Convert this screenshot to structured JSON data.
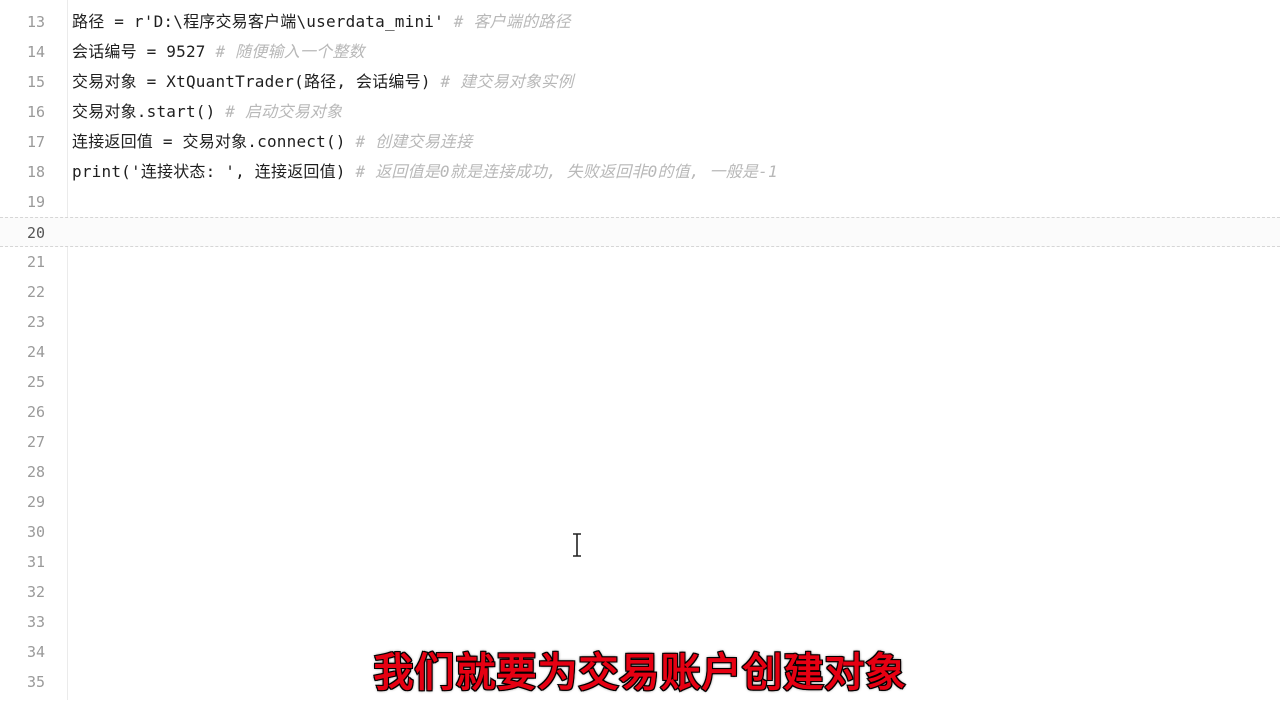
{
  "editor": {
    "lines": [
      {
        "num": "13",
        "code": "路径 = r'D:\\程序交易客户端\\userdata_mini' ",
        "comment": "# 客户端的路径"
      },
      {
        "num": "14",
        "code": "会话编号 = 9527 ",
        "comment": "# 随便输入一个整数"
      },
      {
        "num": "15",
        "code": "交易对象 = XtQuantTrader(路径, 会话编号) ",
        "comment": "# 建交易对象实例"
      },
      {
        "num": "16",
        "code": "交易对象.start() ",
        "comment": "# 启动交易对象"
      },
      {
        "num": "17",
        "code": "连接返回值 = 交易对象.connect() ",
        "comment": "# 创建交易连接"
      },
      {
        "num": "18",
        "code": "print('连接状态: ', 连接返回值) ",
        "comment": "# 返回值是0就是连接成功, 失败返回非0的值, 一般是-1"
      },
      {
        "num": "19",
        "code": "",
        "comment": ""
      },
      {
        "num": "20",
        "code": "",
        "comment": ""
      },
      {
        "num": "21",
        "code": "",
        "comment": ""
      },
      {
        "num": "22",
        "code": "",
        "comment": ""
      },
      {
        "num": "23",
        "code": "",
        "comment": ""
      },
      {
        "num": "24",
        "code": "",
        "comment": ""
      },
      {
        "num": "25",
        "code": "",
        "comment": ""
      },
      {
        "num": "26",
        "code": "",
        "comment": ""
      },
      {
        "num": "27",
        "code": "",
        "comment": ""
      },
      {
        "num": "28",
        "code": "",
        "comment": ""
      },
      {
        "num": "29",
        "code": "",
        "comment": ""
      },
      {
        "num": "30",
        "code": "",
        "comment": ""
      },
      {
        "num": "31",
        "code": "",
        "comment": ""
      },
      {
        "num": "32",
        "code": "",
        "comment": ""
      },
      {
        "num": "33",
        "code": "",
        "comment": ""
      },
      {
        "num": "34",
        "code": "",
        "comment": ""
      },
      {
        "num": "35",
        "code": "",
        "comment": ""
      }
    ],
    "current_line": "20"
  },
  "subtitle": "我们就要为交易账户创建对象",
  "colors": {
    "comment": "#b8b8b8",
    "subtitle": "#e60012"
  }
}
